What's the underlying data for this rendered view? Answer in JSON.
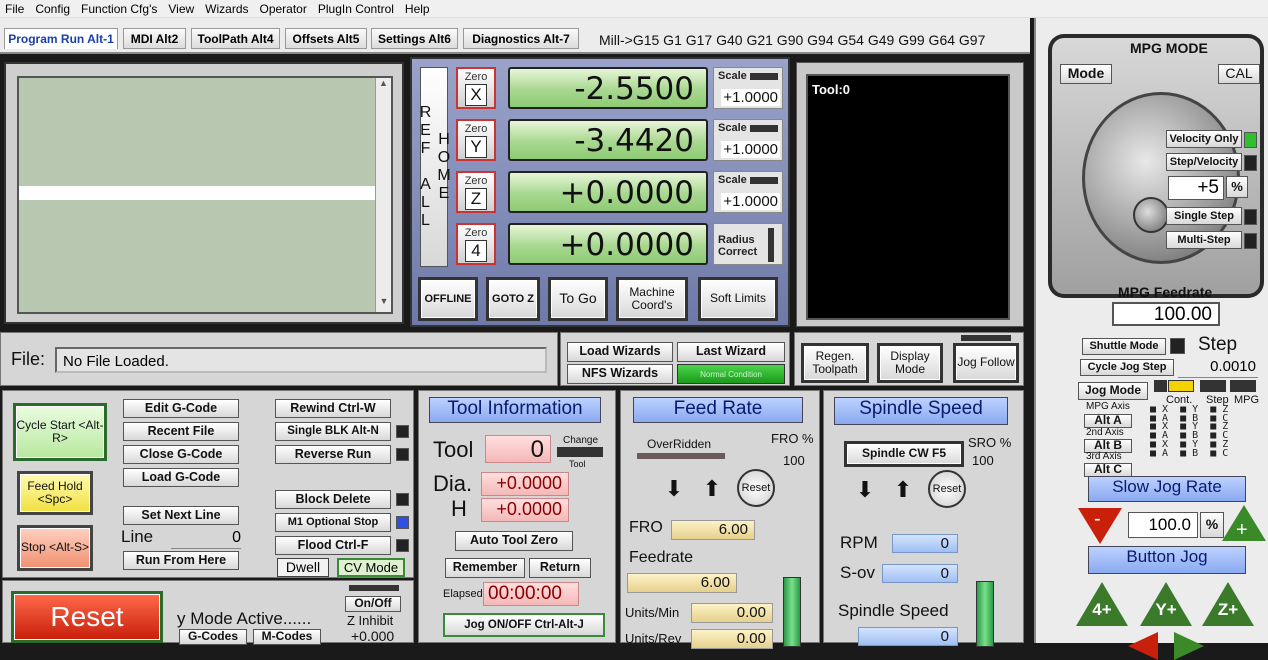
{
  "menu": [
    "File",
    "Config",
    "Function Cfg's",
    "View",
    "Wizards",
    "Operator",
    "PlugIn Control",
    "Help"
  ],
  "tabs": [
    "Program Run Alt-1",
    "MDI Alt2",
    "ToolPath Alt4",
    "Offsets Alt5",
    "Settings Alt6",
    "Diagnostics Alt-7"
  ],
  "modal": "Mill->G15  G1 G17 G40 G21 G90 G94 G54 G49 G99 G64 G97",
  "ref_all_home": "REF ALL HOME",
  "axes": [
    {
      "zero_label": "Zero",
      "axis": "X",
      "value": "-2.5500",
      "aux_label": "Scale",
      "aux_value": "+1.0000"
    },
    {
      "zero_label": "Zero",
      "axis": "Y",
      "value": "-3.4420",
      "aux_label": "Scale",
      "aux_value": "+1.0000"
    },
    {
      "zero_label": "Zero",
      "axis": "Z",
      "value": "+0.0000",
      "aux_label": "Scale",
      "aux_value": "+1.0000"
    },
    {
      "zero_label": "Zero",
      "axis": "4",
      "value": "+0.0000",
      "aux_label": "Radius Correct",
      "aux_value": ""
    }
  ],
  "dro_buttons": {
    "offline": "OFFLINE",
    "goto_z": "GOTO Z",
    "to_go": "To Go",
    "machine": "Machine Coord's",
    "soft": "Soft Limits"
  },
  "tool_display": "Tool:0",
  "file": {
    "label": "File:",
    "value": "No File Loaded."
  },
  "wizards": {
    "load": "Load Wizards",
    "last": "Last Wizard",
    "nfs": "NFS Wizards",
    "status": "Normal Condition"
  },
  "view_buttons": {
    "regen": "Regen. Toolpath",
    "display": "Display Mode",
    "jog_follow": "Jog Follow"
  },
  "program": {
    "cycle_start": "Cycle Start <Alt-R>",
    "feed_hold": "Feed Hold <Spc>",
    "stop": "Stop <Alt-S>",
    "edit": "Edit G-Code",
    "recent": "Recent File",
    "close": "Close G-Code",
    "load": "Load G-Code",
    "set_next": "Set Next Line",
    "line_label": "Line",
    "line_value": "0",
    "run_from": "Run From Here",
    "rewind": "Rewind Ctrl-W",
    "single_blk": "Single BLK Alt-N",
    "reverse": "Reverse Run",
    "block_delete": "Block Delete",
    "m1": "M1 Optional Stop",
    "flood": "Flood Ctrl-F",
    "dwell": "Dwell",
    "cv": "CV Mode"
  },
  "reset": {
    "label": "Reset",
    "mode": "y Mode Active......",
    "gcodes": "G-Codes",
    "mcodes": "M-Codes",
    "onoff": "On/Off",
    "zinhibit": "Z Inhibit",
    "zval": "+0.000"
  },
  "tool": {
    "header": "Tool Information",
    "tool_label": "Tool",
    "tool_value": "0",
    "change": "Change",
    "change_sub": "Tool",
    "dia_label": "Dia.",
    "dia_value": "+0.0000",
    "h_label": "H",
    "h_value": "+0.0000",
    "auto_zero": "Auto Tool Zero",
    "remember": "Remember",
    "return": "Return",
    "elapsed_label": "Elapsed",
    "elapsed": "00:00:00",
    "jog_onoff": "Jog ON/OFF Ctrl-Alt-J"
  },
  "feed": {
    "header": "Feed Rate",
    "overridden": "OverRidden",
    "fro_pct_label": "FRO %",
    "fro_pct": "100",
    "reset": "Reset",
    "fro_label": "FRO",
    "fro_value": "6.00",
    "feedrate_label": "Feedrate",
    "feedrate_value": "6.00",
    "upm_label": "Units/Min",
    "upm_value": "0.00",
    "upr_label": "Units/Rev",
    "upr_value": "0.00"
  },
  "spindle": {
    "header": "Spindle Speed",
    "cw": "Spindle CW F5",
    "sro_label": "SRO %",
    "sro_value": "100",
    "reset": "Reset",
    "rpm_label": "RPM",
    "rpm_value": "0",
    "sov_label": "S-ov",
    "sov_value": "0",
    "speed_label": "Spindle Speed",
    "speed_value": "0"
  },
  "mpg": {
    "title": "MPG MODE",
    "mode": "Mode",
    "cal": "CAL",
    "velocity_only": "Velocity Only",
    "step_velocity": "Step/Velocity",
    "step_value": "+5",
    "pct": "%",
    "single_step": "Single Step",
    "multi_step": "Multi-Step",
    "feedrate_label": "MPG Feedrate",
    "feedrate_value": "100.00"
  },
  "jog": {
    "shuttle": "Shuttle Mode",
    "step_label": "Step",
    "cycle_step": "Cycle Jog Step",
    "step_value": "0.0010",
    "jog_mode": "Jog Mode",
    "cont": "Cont.",
    "step_col": "Step",
    "mpg_col": "MPG",
    "mpg_axis": "MPG Axis",
    "alt_a": "Alt A",
    "second_axis": "2nd Axis",
    "alt_b": "Alt B",
    "third_axis": "3rd Axis",
    "alt_c": "Alt C",
    "slow_jog": "Slow Jog Rate",
    "slow_value": "100.0",
    "pct": "%",
    "button_jog": "Button Jog",
    "minus": "-",
    "plus": "+",
    "btn4": "4+",
    "btny": "Y+",
    "btnz": "Z+"
  }
}
